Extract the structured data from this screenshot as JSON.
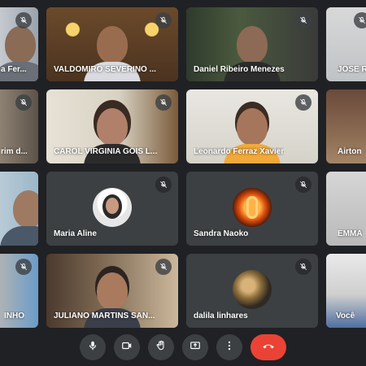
{
  "app": {
    "background_color": "#202124",
    "tile_color": "#3c4043",
    "self_border_color": "#8ab4f8",
    "end_call_color": "#ea4335"
  },
  "participants": [
    {
      "name": "a Fer...",
      "muted": true,
      "kind": "video"
    },
    {
      "name": "VALDOMIRO SEVERINO ...",
      "muted": true,
      "kind": "video"
    },
    {
      "name": "Daniel Ribeiro Menezes",
      "muted": true,
      "kind": "video"
    },
    {
      "name": "JOSE R",
      "muted": true,
      "kind": "video"
    },
    {
      "name": "rim d...",
      "muted": true,
      "kind": "video"
    },
    {
      "name": "CAROL VIRGINIA GOIS L...",
      "muted": true,
      "kind": "video"
    },
    {
      "name": "Leonardo Ferraz Xavier",
      "muted": true,
      "kind": "video"
    },
    {
      "name": "Airton",
      "muted": true,
      "kind": "video"
    },
    {
      "name": "",
      "muted": false,
      "kind": "video"
    },
    {
      "name": "Maria Aline",
      "muted": true,
      "kind": "avatar"
    },
    {
      "name": "Sandra Naoko",
      "muted": true,
      "kind": "avatar"
    },
    {
      "name": "EMMA",
      "muted": false,
      "kind": "video"
    },
    {
      "name": "INHO",
      "muted": true,
      "kind": "video"
    },
    {
      "name": "JULIANO MARTINS SAN...",
      "muted": true,
      "kind": "video"
    },
    {
      "name": "dalila linhares",
      "muted": true,
      "kind": "avatar"
    },
    {
      "name": "Você",
      "muted": false,
      "kind": "self"
    }
  ],
  "toolbar": {
    "buttons": [
      {
        "icon": "microphone-icon"
      },
      {
        "icon": "camera-icon"
      },
      {
        "icon": "raise-hand-icon"
      },
      {
        "icon": "present-screen-icon"
      },
      {
        "icon": "more-options-icon"
      },
      {
        "icon": "end-call-icon"
      }
    ]
  }
}
